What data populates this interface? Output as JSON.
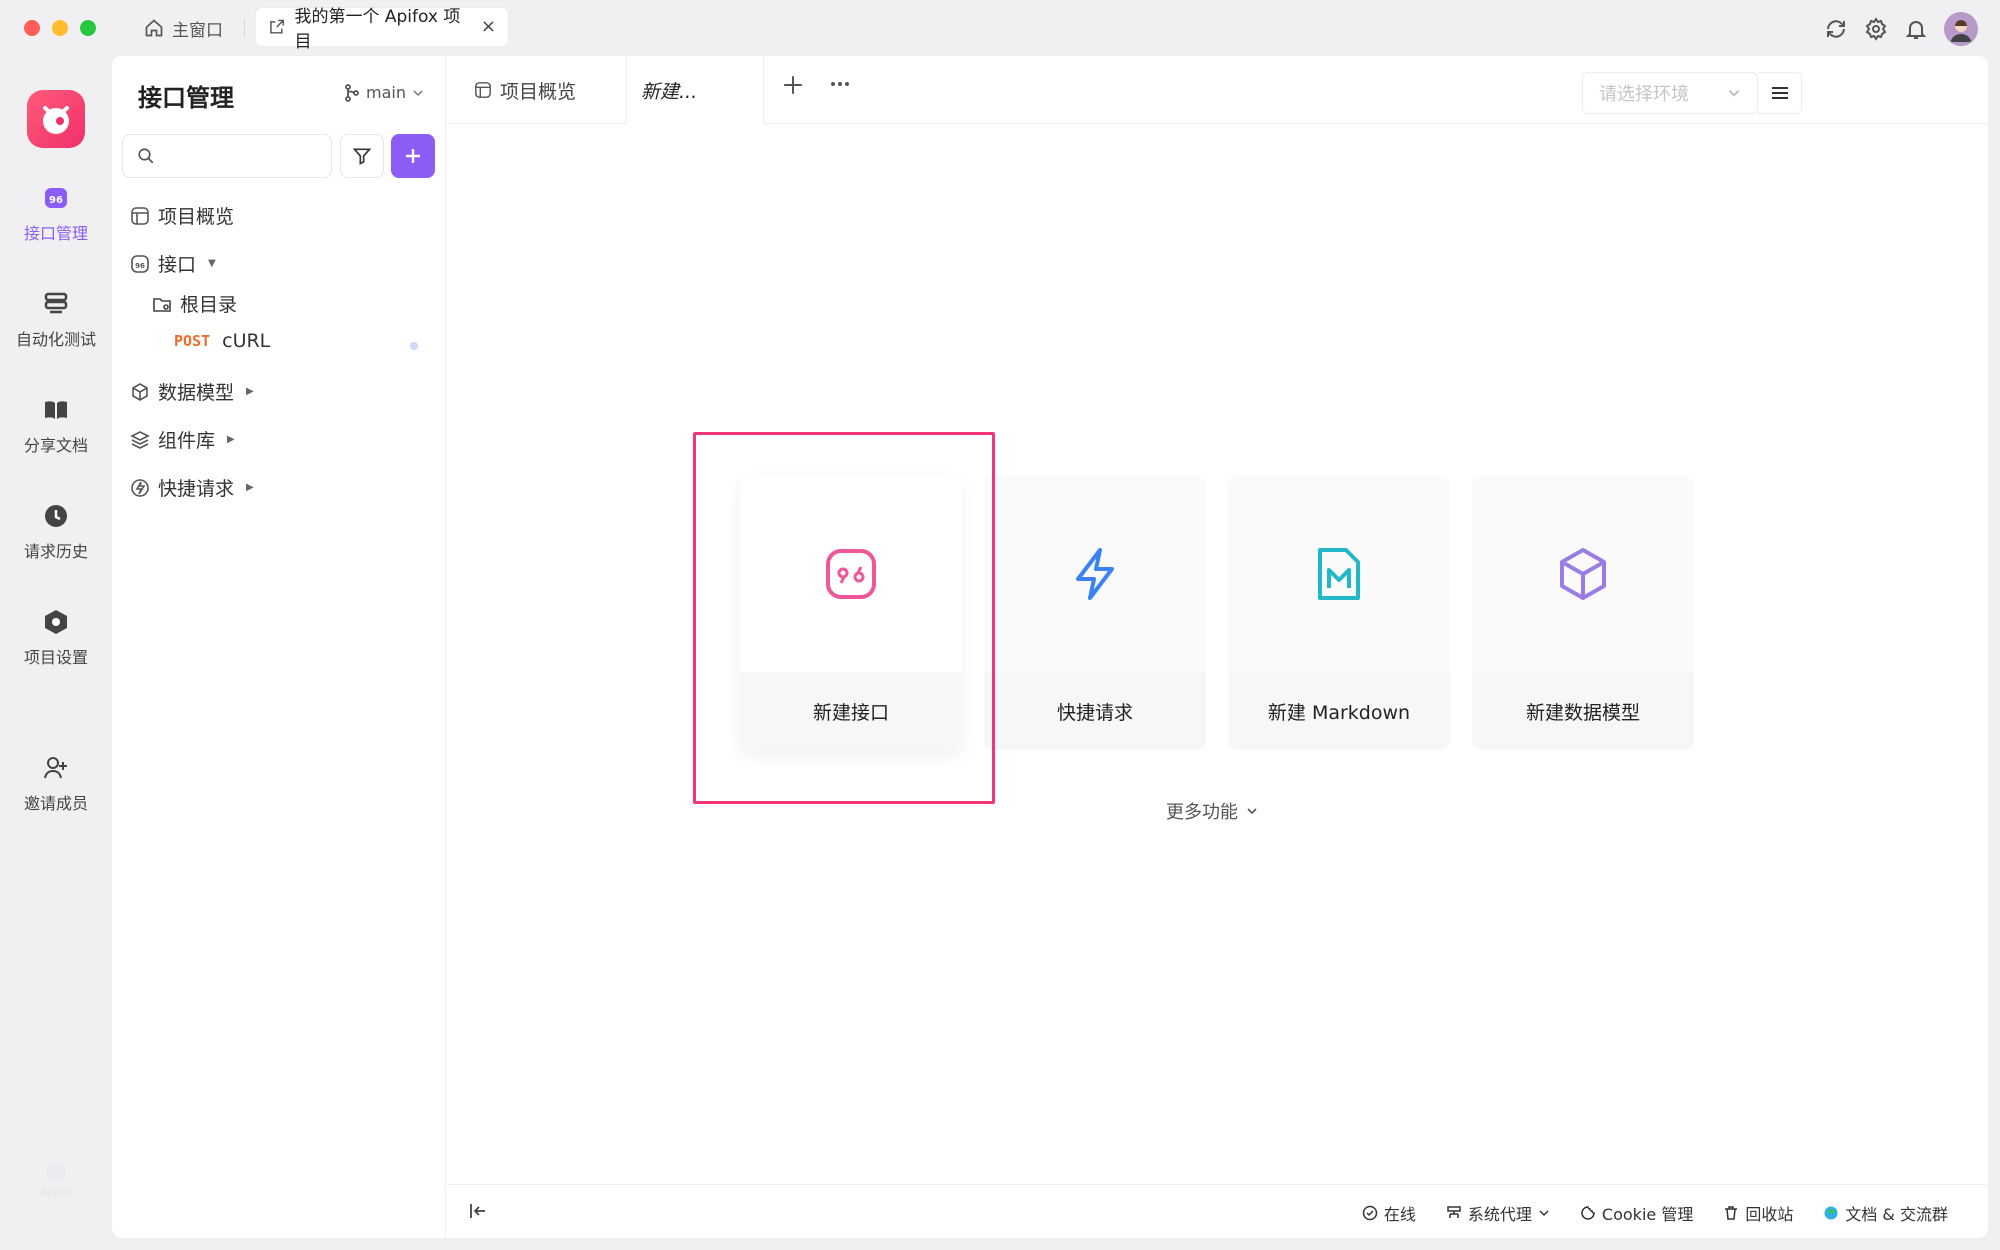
{
  "window": {
    "home_tab": "主窗口",
    "project_tab": "我的第一个 Apifox 项目",
    "close_glyph": "×"
  },
  "rail": {
    "items": [
      {
        "label": "接口管理",
        "icon": "api-icon",
        "active": true
      },
      {
        "label": "自动化测试",
        "icon": "automation-icon",
        "active": false
      },
      {
        "label": "分享文档",
        "icon": "book-icon",
        "active": false
      },
      {
        "label": "请求历史",
        "icon": "clock-icon",
        "active": false
      },
      {
        "label": "项目设置",
        "icon": "settings-hex-icon",
        "active": false
      },
      {
        "label": "邀请成员",
        "icon": "add-user-icon",
        "active": false
      }
    ]
  },
  "sidebar": {
    "title": "接口管理",
    "branch": "main",
    "search_placeholder": "",
    "tree": {
      "overview": "项目概览",
      "api": "接口",
      "root": "根目录",
      "request_method": "POST",
      "request_name": "cURL",
      "models": "数据模型",
      "components": "组件库",
      "quick": "快捷请求"
    }
  },
  "tabs": {
    "overview": "项目概览",
    "new": "新建...",
    "env_placeholder": "请选择环境"
  },
  "cards": [
    {
      "label": "新建接口",
      "icon": "api-icon",
      "color": "#f0569a"
    },
    {
      "label": "快捷请求",
      "icon": "lightning-icon",
      "color": "#3b82f6"
    },
    {
      "label": "新建 Markdown",
      "icon": "markdown-icon",
      "color": "#22b8c8"
    },
    {
      "label": "新建数据模型",
      "icon": "cube-icon",
      "color": "#9b7ce6"
    }
  ],
  "more_functions": "更多功能",
  "statusbar": {
    "online": "在线",
    "proxy": "系统代理",
    "cookie": "Cookie 管理",
    "recycle": "回收站",
    "docs": "文档 & 交流群"
  },
  "colors": {
    "accent": "#8b5cf6",
    "highlight": "#f0357a",
    "post": "#ef6c2c"
  }
}
